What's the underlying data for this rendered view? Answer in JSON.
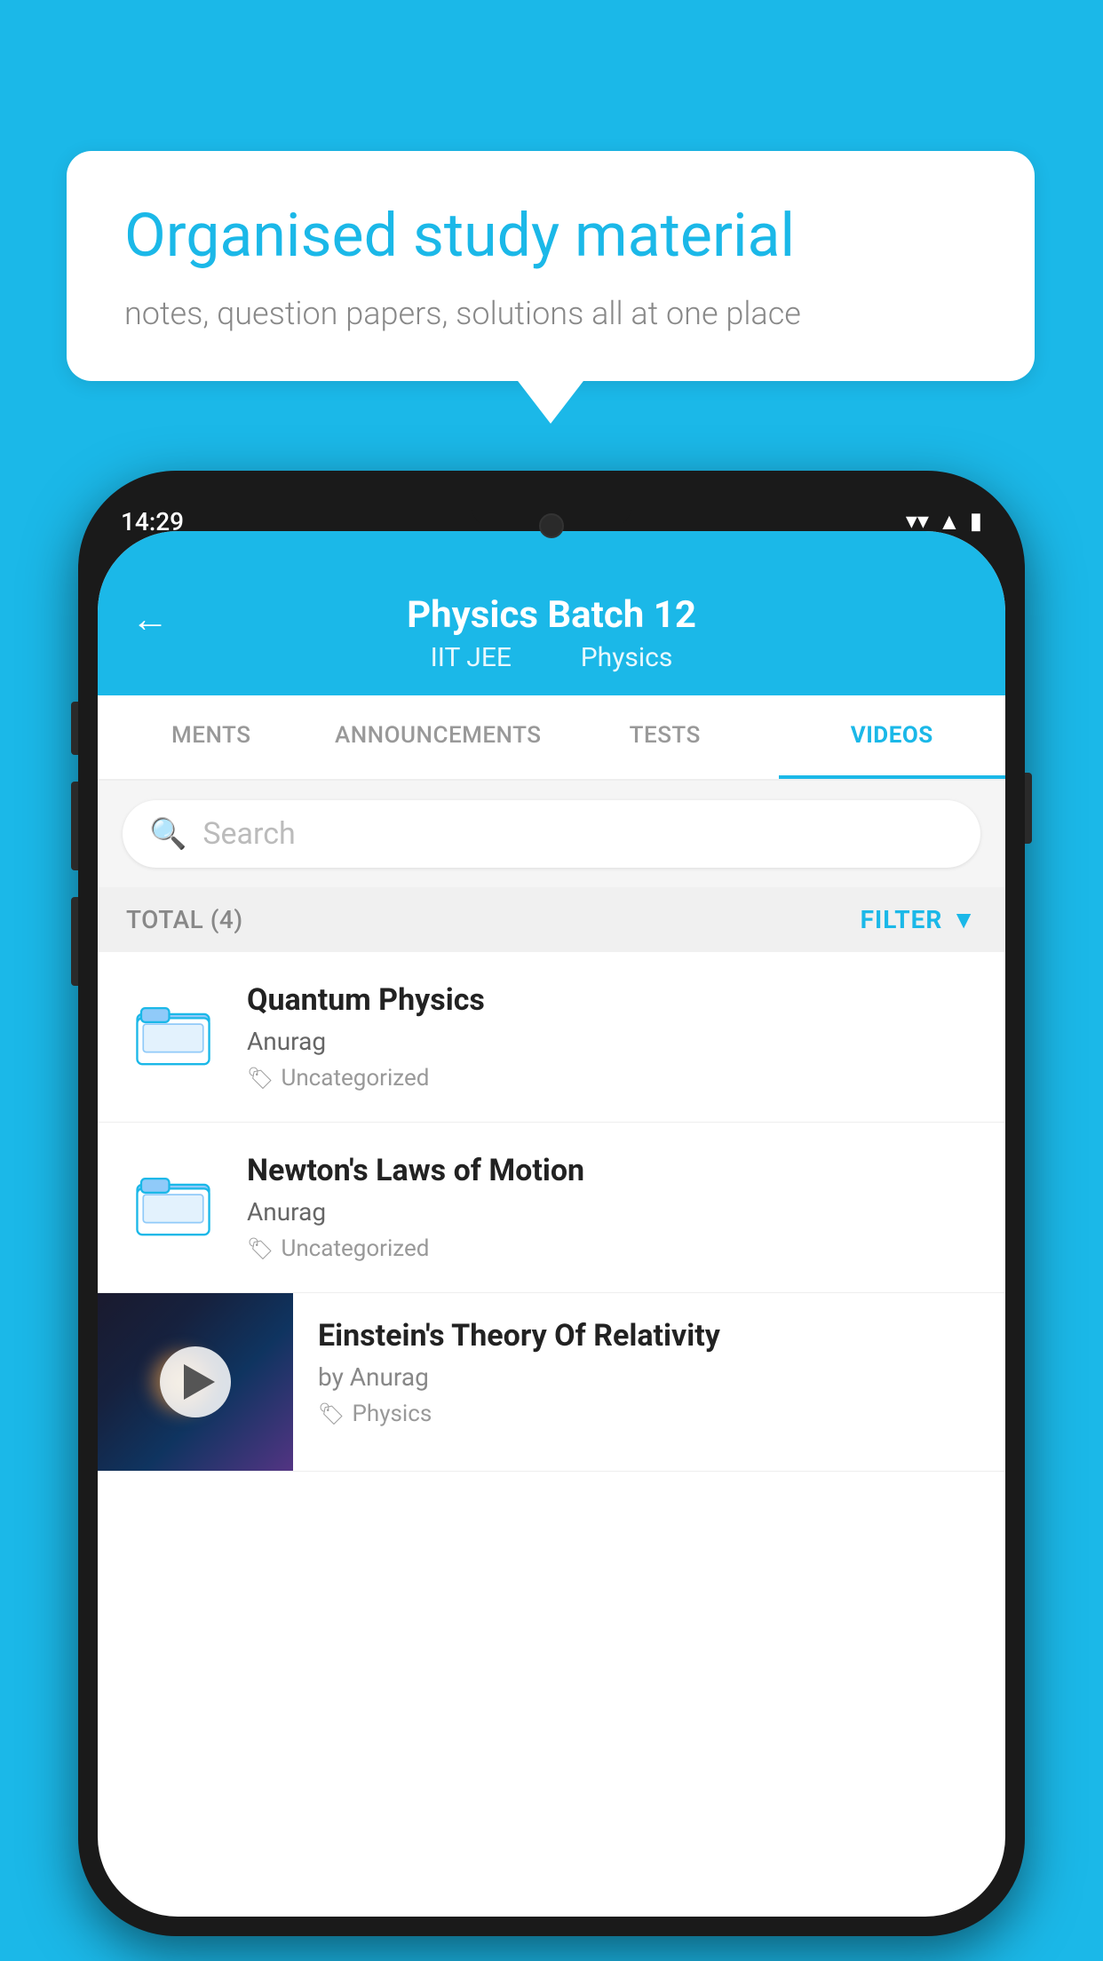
{
  "background_color": "#1BB8E8",
  "speech_bubble": {
    "title": "Organised study material",
    "subtitle": "notes, question papers, solutions all at one place"
  },
  "phone": {
    "status_bar": {
      "time": "14:29"
    },
    "header": {
      "title": "Physics Batch 12",
      "subtitle_part1": "IIT JEE",
      "subtitle_part2": "Physics",
      "back_label": "←"
    },
    "tabs": [
      {
        "label": "MENTS",
        "active": false
      },
      {
        "label": "ANNOUNCEMENTS",
        "active": false
      },
      {
        "label": "TESTS",
        "active": false
      },
      {
        "label": "VIDEOS",
        "active": true
      }
    ],
    "search": {
      "placeholder": "Search"
    },
    "filter_row": {
      "total_label": "TOTAL (4)",
      "filter_label": "FILTER"
    },
    "videos": [
      {
        "title": "Quantum Physics",
        "author": "Anurag",
        "tag": "Uncategorized",
        "has_thumbnail": false
      },
      {
        "title": "Newton's Laws of Motion",
        "author": "Anurag",
        "tag": "Uncategorized",
        "has_thumbnail": false
      },
      {
        "title": "Einstein's Theory Of Relativity",
        "author": "by Anurag",
        "tag": "Physics",
        "has_thumbnail": true
      }
    ]
  }
}
